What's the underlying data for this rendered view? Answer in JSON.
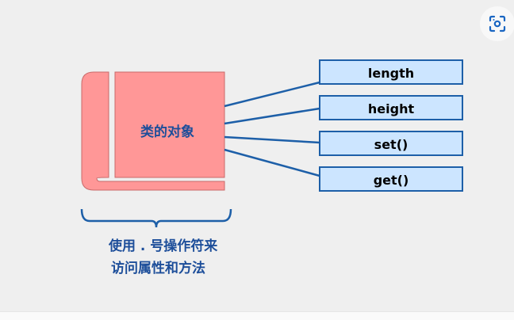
{
  "diagram": {
    "object_label": "类的对象",
    "members": [
      {
        "label": "length"
      },
      {
        "label": "height"
      },
      {
        "label": "set()"
      },
      {
        "label": "get()"
      }
    ],
    "caption_line1": "使用 . 号操作符来",
    "caption_line2": "访问属性和方法"
  },
  "colors": {
    "background": "#efefef",
    "book_fill": "#ff9797",
    "book_stroke": "#c96a6a",
    "text_blue": "#1d4e9a",
    "member_fill": "#cce5ff",
    "member_stroke": "#1d5fa8",
    "connector": "#1d5fa8"
  },
  "toolbar": {
    "scan_icon": "visual-search-icon"
  }
}
